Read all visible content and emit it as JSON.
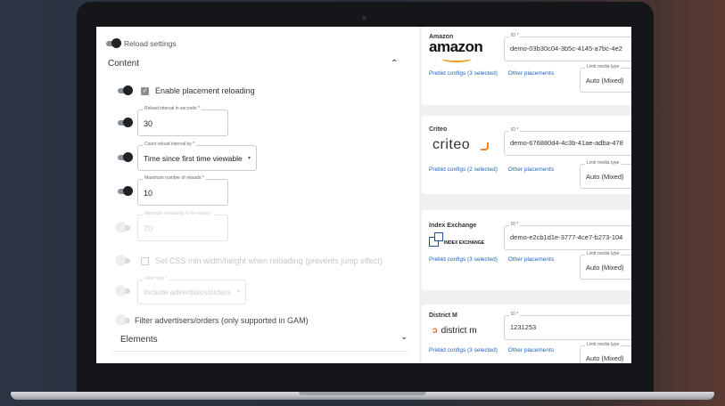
{
  "left_panel": {
    "reload_settings_label": "Reload settings",
    "content_section": "Content",
    "enable_reloading_label": "Enable placement reloading",
    "reload_interval": {
      "label": "Reload interval in seconds *",
      "value": "30"
    },
    "count_interval": {
      "label": "Count reload interval by *",
      "value": "Time since first time viewable"
    },
    "max_reloads": {
      "label": "Maximum number of reloads *",
      "value": "10"
    },
    "min_viewability": {
      "label": "Minimum viewability % for reload *",
      "value": "70"
    },
    "css_min_label": "Set CSS min width/height when reloading (prevents jump effect)",
    "filter_type": {
      "label": "Filter type *",
      "value": "Include advertisers/orders"
    },
    "filter_advertisers_label": "Filter advertisers/orders (only supported in GAM)",
    "elements_section": "Elements"
  },
  "bidders": [
    {
      "name": "Amazon",
      "logo": "amazon",
      "id_label": "ID *",
      "id_value": "demo-03b30c04-3b5c-4145-a7bc-4e2",
      "prebid": "Prebid configs (3 selected)",
      "other": "Other placements",
      "media_label": "Limit media type",
      "media_value": "Auto (Mixed)"
    },
    {
      "name": "Criteo",
      "logo": "criteo",
      "id_label": "ID *",
      "id_value": "demo-676880d4-4c3b-41ae-adba-478",
      "prebid": "Prebid configs (2 selected)",
      "other": "Other placements",
      "media_label": "Limit media type",
      "media_value": "Auto (Mixed)"
    },
    {
      "name": "Index Exchange",
      "logo": "INDEX EXCHANGE",
      "id_label": "ID *",
      "id_value": "demo-e2cb1d1e-3777-4ce7-b273-104",
      "prebid": "Prebid configs (3 selected)",
      "other": "Other placements",
      "media_label": "Limit media type",
      "media_value": "Auto (Mixed)"
    },
    {
      "name": "District M",
      "logo": "district m",
      "id_label": "ID *",
      "id_value": "1231253",
      "prebid": "Prebid configs (3 selected)",
      "other": "Other placements",
      "media_label": "Limit media type",
      "media_value": "Auto (Mixed)"
    }
  ],
  "icons": {
    "chevron_up": "⌃",
    "chevron_down": "⌄",
    "caret": "▾",
    "check": "✓"
  }
}
